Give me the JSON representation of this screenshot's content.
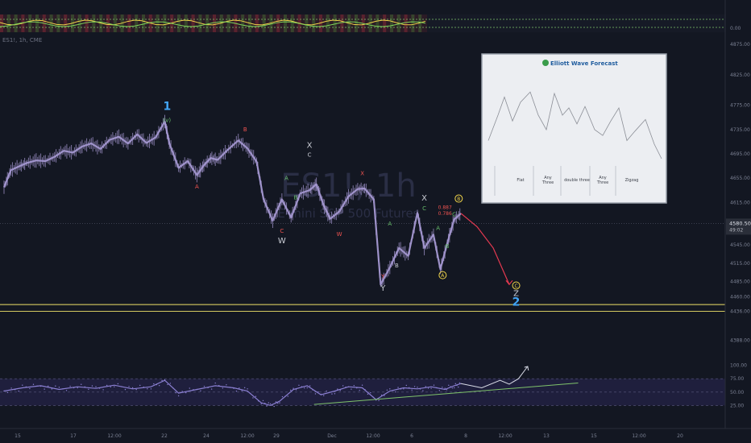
{
  "chart_data": {
    "type": "line",
    "symbol_watermark": "ES1!, 1h",
    "subtitle_watermark": "E-mini S&P 500 Futures",
    "header_short": "ES1!, 1h, CME",
    "y_axis_ticks": [
      4875,
      4825,
      4775,
      4735,
      4695,
      4655,
      4615,
      4545,
      4515,
      4485,
      4460,
      4436,
      4388
    ],
    "y_range": [
      4365,
      4895
    ],
    "current_price": "4580.50",
    "countdown": "49:02",
    "rsi_ticks": [
      "100.00",
      "75.00",
      "50.00",
      "25.00"
    ],
    "top_indicator_tick": "0.00",
    "x_tick_labels": [
      "15",
      "17",
      "12:00",
      "22",
      "24",
      "12:00",
      "29",
      "Dec",
      "12:00",
      "6",
      "8",
      "12:00",
      "13",
      "15",
      "12:00",
      "20"
    ],
    "price_path": [
      [
        0.0,
        4640
      ],
      [
        0.3,
        4668
      ],
      [
        0.7,
        4675
      ],
      [
        1.0,
        4680
      ],
      [
        1.4,
        4684
      ],
      [
        1.8,
        4683
      ],
      [
        2.2,
        4690
      ],
      [
        2.6,
        4700
      ],
      [
        3.0,
        4697
      ],
      [
        3.4,
        4707
      ],
      [
        3.8,
        4712
      ],
      [
        4.2,
        4703
      ],
      [
        4.6,
        4718
      ],
      [
        5.0,
        4723
      ],
      [
        5.4,
        4712
      ],
      [
        5.8,
        4727
      ],
      [
        6.2,
        4713
      ],
      [
        6.6,
        4722
      ],
      [
        7.0,
        4748
      ],
      [
        7.2,
        4712
      ],
      [
        7.6,
        4672
      ],
      [
        8.0,
        4683
      ],
      [
        8.4,
        4660
      ],
      [
        8.7,
        4676
      ],
      [
        9.0,
        4688
      ],
      [
        9.3,
        4685
      ],
      [
        9.7,
        4700
      ],
      [
        10.2,
        4717
      ],
      [
        10.6,
        4704
      ],
      [
        11.0,
        4682
      ],
      [
        11.3,
        4620
      ],
      [
        11.7,
        4585
      ],
      [
        12.1,
        4620
      ],
      [
        12.5,
        4590
      ],
      [
        12.9,
        4630
      ],
      [
        13.3,
        4635
      ],
      [
        13.6,
        4645
      ],
      [
        13.9,
        4612
      ],
      [
        14.2,
        4588
      ],
      [
        14.6,
        4600
      ],
      [
        15.0,
        4625
      ],
      [
        15.4,
        4637
      ],
      [
        15.7,
        4638
      ],
      [
        16.1,
        4620
      ],
      [
        16.4,
        4480
      ],
      [
        16.8,
        4508
      ],
      [
        17.2,
        4540
      ],
      [
        17.6,
        4527
      ],
      [
        18.0,
        4598
      ],
      [
        18.3,
        4540
      ],
      [
        18.7,
        4562
      ],
      [
        19.0,
        4505
      ],
      [
        19.3,
        4548
      ],
      [
        19.6,
        4587
      ],
      [
        19.9,
        4597
      ]
    ],
    "projection_path": [
      [
        19.9,
        4597
      ],
      [
        20.6,
        4575
      ],
      [
        21.3,
        4540
      ],
      [
        22.0,
        4480
      ]
    ],
    "wave_labels": [
      {
        "text": "1",
        "day": 7.1,
        "price": 4767,
        "color": "#42a5f5"
      },
      {
        "text": "(v)",
        "day": 7.1,
        "price": 4747,
        "color": "#66bb6a"
      },
      {
        "text": "B",
        "day": 10.5,
        "price": 4732,
        "color": "#ef5350"
      },
      {
        "text": "A",
        "day": 8.4,
        "price": 4638,
        "color": "#ef5350"
      },
      {
        "text": "X",
        "day": 13.3,
        "price": 4705,
        "color": "#c9ccd4"
      },
      {
        "text": "C",
        "day": 13.3,
        "price": 4690,
        "color": "#c9ccd4"
      },
      {
        "text": "A",
        "day": 12.3,
        "price": 4652,
        "color": "#66bb6a"
      },
      {
        "text": "B",
        "day": 12.7,
        "price": 4620,
        "color": "#66bb6a"
      },
      {
        "text": "C",
        "day": 12.1,
        "price": 4565,
        "color": "#ef5350"
      },
      {
        "text": "W",
        "day": 12.1,
        "price": 4548,
        "color": "#c9ccd4"
      },
      {
        "text": "W",
        "day": 14.6,
        "price": 4560,
        "color": "#ef5350"
      },
      {
        "text": "X",
        "day": 15.6,
        "price": 4660,
        "color": "#ef5350"
      },
      {
        "text": "Y",
        "day": 16.5,
        "price": 4490,
        "color": "#ef5350"
      },
      {
        "text": "Y",
        "day": 16.5,
        "price": 4470,
        "color": "#c9ccd4"
      },
      {
        "text": "B",
        "day": 17.1,
        "price": 4508,
        "color": "#c9ccd4"
      },
      {
        "text": "A",
        "day": 16.8,
        "price": 4577,
        "color": "#66bb6a"
      },
      {
        "text": "X",
        "day": 18.3,
        "price": 4618,
        "color": "#c9ccd4"
      },
      {
        "text": "C",
        "day": 18.3,
        "price": 4602,
        "color": "#66bb6a"
      },
      {
        "text": "A",
        "day": 18.9,
        "price": 4570,
        "color": "#66bb6a"
      },
      {
        "text": "B",
        "day": 19.3,
        "price": 4540,
        "color": "#66bb6a"
      },
      {
        "text": "C",
        "day": 19.6,
        "price": 4592,
        "color": "#66bb6a"
      },
      {
        "text": "Z",
        "day": 22.3,
        "price": 4461,
        "color": "#c9ccd4"
      },
      {
        "text": "2",
        "day": 22.3,
        "price": 4445,
        "color": "#42a5f5"
      }
    ],
    "circled_labels": [
      {
        "text": "B",
        "day": 19.8,
        "price": 4618,
        "color": "#f0d44a"
      },
      {
        "text": "A",
        "day": 19.1,
        "price": 4492,
        "color": "#f0d44a"
      },
      {
        "text": "C",
        "day": 22.3,
        "price": 4475,
        "color": "#f0d44a"
      }
    ],
    "fib_labels": [
      {
        "text": "0.887",
        "day": 19.2,
        "price": 4604
      },
      {
        "text": "0.786",
        "day": 19.2,
        "price": 4594
      }
    ],
    "support_lines": [
      4447,
      4436
    ],
    "rsi_path": [
      [
        0.0,
        52
      ],
      [
        0.8,
        58
      ],
      [
        1.6,
        62
      ],
      [
        2.4,
        55
      ],
      [
        3.2,
        60
      ],
      [
        4.0,
        57
      ],
      [
        4.8,
        63
      ],
      [
        5.6,
        56
      ],
      [
        6.4,
        60
      ],
      [
        7.0,
        72
      ],
      [
        7.6,
        48
      ],
      [
        8.4,
        55
      ],
      [
        9.2,
        62
      ],
      [
        10.0,
        58
      ],
      [
        10.6,
        52
      ],
      [
        11.2,
        30
      ],
      [
        11.6,
        25
      ],
      [
        12.0,
        33
      ],
      [
        12.6,
        55
      ],
      [
        13.2,
        62
      ],
      [
        13.8,
        45
      ],
      [
        14.4,
        52
      ],
      [
        15.0,
        60
      ],
      [
        15.6,
        58
      ],
      [
        16.2,
        36
      ],
      [
        16.8,
        52
      ],
      [
        17.4,
        58
      ],
      [
        18.0,
        56
      ],
      [
        18.6,
        60
      ],
      [
        19.2,
        55
      ],
      [
        19.6,
        62
      ],
      [
        19.9,
        66
      ]
    ],
    "rsi_projection": [
      [
        19.9,
        66
      ],
      [
        20.8,
        58
      ],
      [
        21.6,
        72
      ],
      [
        22.0,
        65
      ],
      [
        22.4,
        75
      ],
      [
        22.8,
        98
      ]
    ],
    "rsi_trendline": [
      [
        13.5,
        27
      ],
      [
        25.0,
        67
      ]
    ],
    "inset": {
      "title": "Elliott Wave Forecast",
      "patterns": [
        "Flat",
        "Any Three",
        "double three",
        "Any Three",
        "Zigzag"
      ]
    }
  },
  "colors": {
    "background": "#131722",
    "price": "#a99bd6",
    "projection": "#e53950",
    "rsi": "#8a7fd1",
    "rsi_band": "#2a2653",
    "trend": "#7fc36b",
    "support": "#f0e36a",
    "axis_text": "#7b8093"
  }
}
